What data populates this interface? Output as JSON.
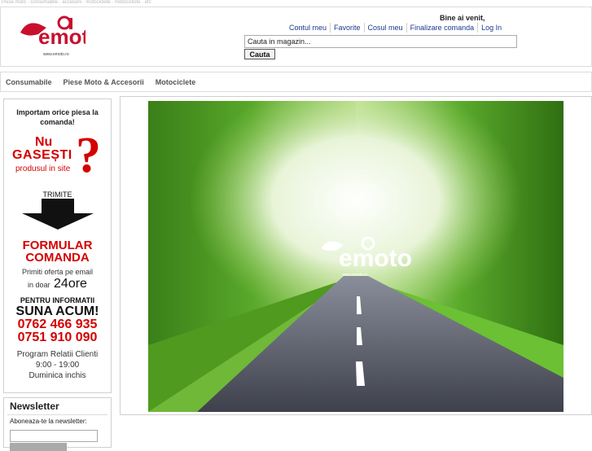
{
  "site": {
    "tagline": "Piese moto · consumabile · accesorii · motociclete · motocicliste · etc",
    "logo_text": "emoto",
    "logo_url_text": "www.emoto.ro"
  },
  "header": {
    "welcome": "Bine ai venit,",
    "links": [
      "Contul meu",
      "Favorite",
      "Cosul meu",
      "Finalizare comanda",
      "Log In"
    ],
    "search_placeholder": "Cauta in magazin...",
    "search_button": "Cauta"
  },
  "nav": {
    "items": [
      "Consumabile",
      "Piese Moto & Accesorii",
      "Motociclete"
    ]
  },
  "sidebar_ad": {
    "line1": "Importam orice piesa la comanda!",
    "nu": "Nu",
    "gasesti": "GASEȘTI",
    "produsul": "produsul in site",
    "qmark": "?",
    "trimite": "TRIMITE",
    "formular1": "FORMULAR",
    "formular2": "COMANDA",
    "primiti": "Primiti oferta pe email",
    "doar": "in doar",
    "ore": "24ore",
    "pentru": "PENTRU INFORMATII",
    "suna": "SUNA ACUM!",
    "phone1": "0762 466 935",
    "phone2": "0751 910 090",
    "program_title": "Program Relatii Clienti",
    "program_hours": "9:00 - 19:00",
    "program_sunday": "Duminica inchis"
  },
  "newsletter": {
    "title": "Newsletter",
    "label": "Aboneaza-te la newsletter:"
  },
  "hero": {
    "logo_text": "emoto",
    "logo_url_text": "www.emoto.ro"
  },
  "colors": {
    "accent_red": "#d40000",
    "link_blue": "#1a3a8f"
  }
}
